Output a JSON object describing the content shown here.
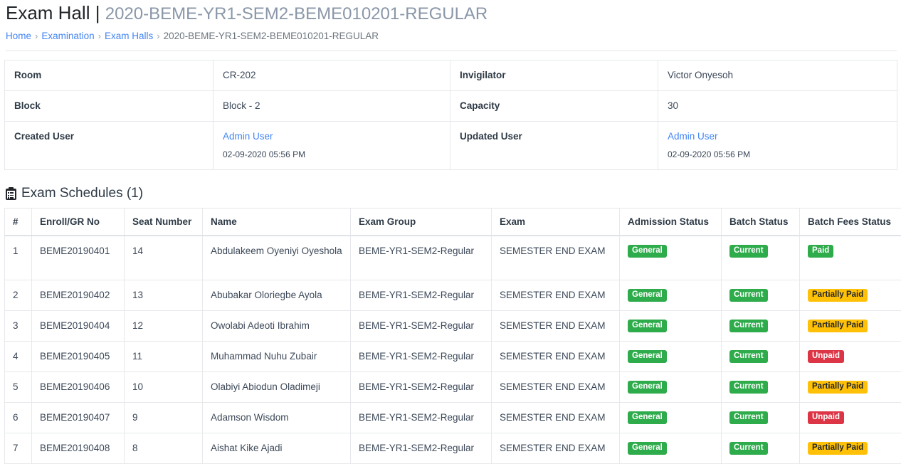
{
  "header": {
    "title_main": "Exam Hall",
    "title_pipe": "|",
    "title_sub": "2020-BEME-YR1-SEM2-BEME010201-REGULAR"
  },
  "breadcrumb": {
    "items": [
      {
        "label": "Home",
        "link": true
      },
      {
        "label": "Examination",
        "link": true
      },
      {
        "label": "Exam Halls",
        "link": true
      },
      {
        "label": "2020-BEME-YR1-SEM2-BEME010201-REGULAR",
        "link": false
      }
    ],
    "separator": "›"
  },
  "info": {
    "rows": [
      {
        "label_left": "Room",
        "value_left": "CR-202",
        "label_right": "Invigilator",
        "value_right": "Victor Onyesoh"
      },
      {
        "label_left": "Block",
        "value_left": "Block - 2",
        "label_right": "Capacity",
        "value_right": "30"
      }
    ],
    "created": {
      "label": "Created User",
      "user": "Admin User",
      "date": "02-09-2020 05:56 PM"
    },
    "updated": {
      "label": "Updated User",
      "user": "Admin User",
      "date": "02-09-2020 05:56 PM"
    }
  },
  "schedules": {
    "icon": "clipboard-list-icon",
    "title": "Exam Schedules (1)",
    "columns": [
      "#",
      "Enroll/GR No",
      "Seat Number",
      "Name",
      "Exam Group",
      "Exam",
      "Admission Status",
      "Batch Status",
      "Batch Fees Status"
    ],
    "rows": [
      {
        "num": "1",
        "enroll": "BEME20190401",
        "seat": "14",
        "name": "Abdulakeem Oyeniyi Oyeshola",
        "group": "BEME-YR1-SEM2-Regular",
        "exam": "SEMESTER END EXAM",
        "admission_status": "General",
        "admission_variant": "success",
        "batch_status": "Current",
        "batch_variant": "success",
        "fees_status": "Paid",
        "fees_variant": "success",
        "tall": true
      },
      {
        "num": "2",
        "enroll": "BEME20190402",
        "seat": "13",
        "name": "Abubakar Oloriegbe Ayola",
        "group": "BEME-YR1-SEM2-Regular",
        "exam": "SEMESTER END EXAM",
        "admission_status": "General",
        "admission_variant": "success",
        "batch_status": "Current",
        "batch_variant": "success",
        "fees_status": "Partially Paid",
        "fees_variant": "warning",
        "tall": false
      },
      {
        "num": "3",
        "enroll": "BEME20190404",
        "seat": "12",
        "name": "Owolabi Adeoti Ibrahim",
        "group": "BEME-YR1-SEM2-Regular",
        "exam": "SEMESTER END EXAM",
        "admission_status": "General",
        "admission_variant": "success",
        "batch_status": "Current",
        "batch_variant": "success",
        "fees_status": "Partially Paid",
        "fees_variant": "warning",
        "tall": false
      },
      {
        "num": "4",
        "enroll": "BEME20190405",
        "seat": "11",
        "name": "Muhammad Nuhu Zubair",
        "group": "BEME-YR1-SEM2-Regular",
        "exam": "SEMESTER END EXAM",
        "admission_status": "General",
        "admission_variant": "success",
        "batch_status": "Current",
        "batch_variant": "success",
        "fees_status": "Unpaid",
        "fees_variant": "danger",
        "tall": false
      },
      {
        "num": "5",
        "enroll": "BEME20190406",
        "seat": "10",
        "name": "Olabiyi Abiodun Oladimeji",
        "group": "BEME-YR1-SEM2-Regular",
        "exam": "SEMESTER END EXAM",
        "admission_status": "General",
        "admission_variant": "success",
        "batch_status": "Current",
        "batch_variant": "success",
        "fees_status": "Partially Paid",
        "fees_variant": "warning",
        "tall": false
      },
      {
        "num": "6",
        "enroll": "BEME20190407",
        "seat": "9",
        "name": "Adamson Wisdom",
        "group": "BEME-YR1-SEM2-Regular",
        "exam": "SEMESTER END EXAM",
        "admission_status": "General",
        "admission_variant": "success",
        "batch_status": "Current",
        "batch_variant": "success",
        "fees_status": "Unpaid",
        "fees_variant": "danger",
        "tall": false
      },
      {
        "num": "7",
        "enroll": "BEME20190408",
        "seat": "8",
        "name": "Aishat Kike Ajadi",
        "group": "BEME-YR1-SEM2-Regular",
        "exam": "SEMESTER END EXAM",
        "admission_status": "General",
        "admission_variant": "success",
        "batch_status": "Current",
        "batch_variant": "success",
        "fees_status": "Partially Paid",
        "fees_variant": "warning",
        "tall": false
      }
    ]
  },
  "colors": {
    "link": "#4285f4",
    "success": "#2eab4b",
    "warning": "#ffc107",
    "danger": "#dc3545",
    "title_sub": "#8a97a8",
    "border": "#e6e8eb"
  }
}
